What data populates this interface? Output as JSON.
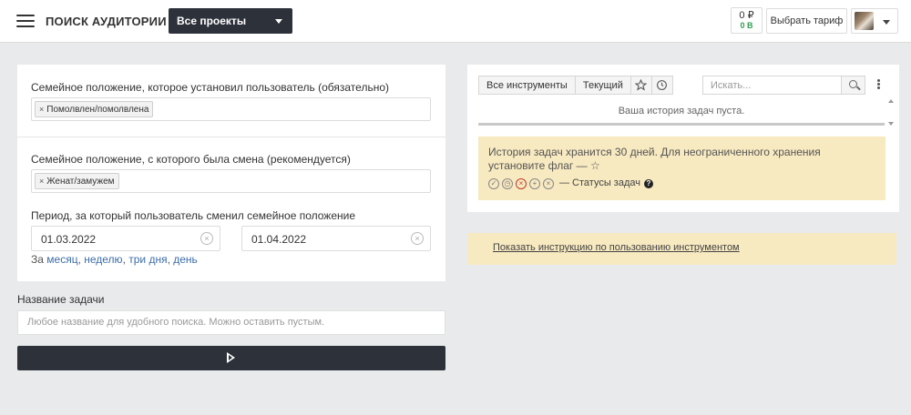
{
  "header": {
    "title": "ПОИСК АУДИТОРИИ",
    "project_select": "Все проекты",
    "balance_rub": "0 ₽",
    "balance_points": "0 B",
    "tariff_button": "Выбрать тариф"
  },
  "form": {
    "marital_current_label": "Семейное положение, которое установил пользователь (обязательно)",
    "marital_current_tag": "Помолвлен/помолвлена",
    "marital_previous_label": "Семейное положение, с которого была смена (рекомендуется)",
    "marital_previous_tag": "Женат/замужем",
    "period_label": "Период, за который пользователь сменил семейное положение",
    "date_from": "01.03.2022",
    "date_to": "01.04.2022",
    "quick_prefix": "За",
    "quick_month": "месяц",
    "quick_week": "неделю",
    "quick_three_days": "три дня",
    "quick_day": "день",
    "task_name_label": "Название задачи",
    "task_name_placeholder": "Любое название для удобного поиска. Можно оставить пустым."
  },
  "tools": {
    "tab_all": "Все инструменты",
    "tab_current": "Текущий",
    "search_placeholder": "Искать...",
    "history_empty": "Ваша история задач пуста.",
    "notice_text": "История задач хранится 30 дней. Для неограниченного хранения установите флаг — ☆",
    "statuses_label": "— Статусы задач",
    "instruction_link": "Показать инструкцию по пользованию инструментом"
  },
  "icons": {
    "menu": "hamburger-icon",
    "star": "star-icon",
    "clock": "clock-icon",
    "search": "search-icon",
    "more": "kebab-icon"
  }
}
